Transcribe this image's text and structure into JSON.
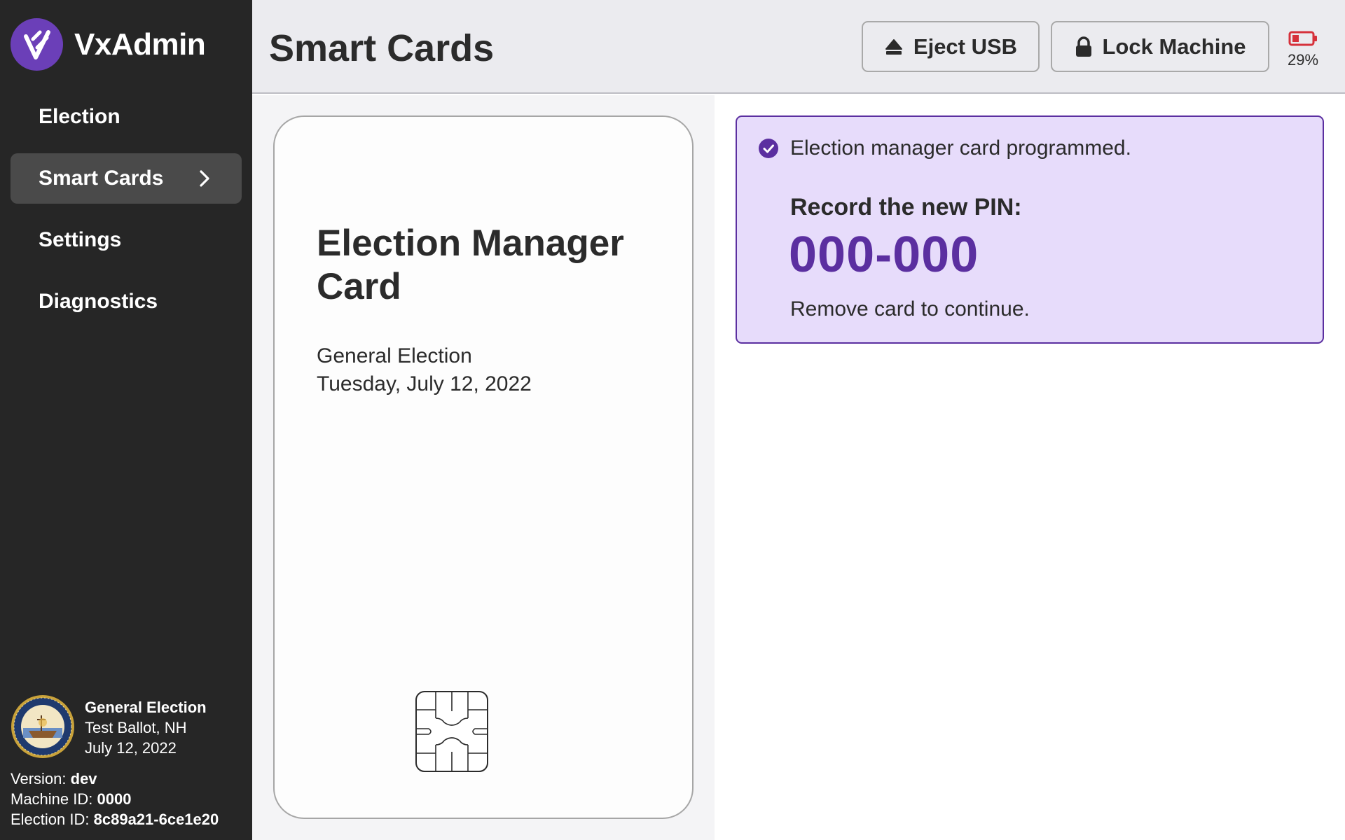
{
  "app": {
    "name": "VxAdmin"
  },
  "nav": {
    "items": [
      {
        "label": "Election"
      },
      {
        "label": "Smart Cards"
      },
      {
        "label": "Settings"
      },
      {
        "label": "Diagnostics"
      }
    ],
    "active": "Smart Cards"
  },
  "election": {
    "title": "General Election",
    "ballot": "Test Ballot, NH",
    "date": "July 12, 2022"
  },
  "machine": {
    "version_label": "Version:",
    "version": "dev",
    "machine_id_label": "Machine ID:",
    "machine_id": "0000",
    "election_id_label": "Election ID:",
    "election_id": "8c89a21-6ce1e20"
  },
  "header": {
    "title": "Smart Cards",
    "eject_label": "Eject USB",
    "lock_label": "Lock Machine",
    "battery_percent": "29%"
  },
  "card": {
    "title": "Election Manager Card",
    "election_title": "General Election",
    "election_date": "Tuesday, July 12, 2022"
  },
  "alert": {
    "message": "Election manager card programmed.",
    "pin_label": "Record the new PIN:",
    "pin": "000-000",
    "instruction": "Remove card to continue."
  },
  "colors": {
    "accent": "#5b2fa0",
    "alert_bg": "#e7dcfb",
    "sidebar_bg": "#262626",
    "battery_low": "#d6313b"
  }
}
